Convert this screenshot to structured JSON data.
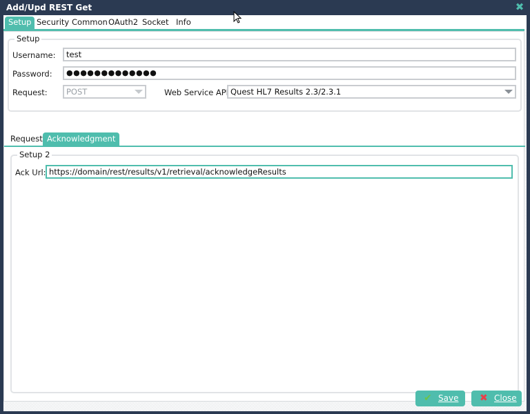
{
  "window": {
    "title": "Add/Upd REST Get",
    "close_icon": "close-x-icon"
  },
  "top_tabs": [
    {
      "label": "Setup",
      "active": true
    },
    {
      "label": "Security",
      "active": false
    },
    {
      "label": "Common",
      "active": false
    },
    {
      "label": "OAuth2",
      "active": false
    },
    {
      "label": "Socket",
      "active": false
    },
    {
      "label": "Info",
      "active": false
    }
  ],
  "setup": {
    "legend": "Setup",
    "username_label": "Username:",
    "username_value": "test",
    "password_label": "Password:",
    "password_value": "●●●●●●●●●●●●●",
    "request_label": "Request:",
    "request_value": "POST",
    "api_label": "Web Service API:",
    "api_value": "Quest HL7 Results 2.3/2.3.1"
  },
  "sub_tabs": [
    {
      "label": "Request",
      "active": false
    },
    {
      "label": "Acknowledgment",
      "active": true
    }
  ],
  "setup2": {
    "legend": "Setup 2",
    "ack_label": "Ack Url:",
    "ack_value": "https://domain/rest/results/v1/retrieval/acknowledgeResults"
  },
  "buttons": {
    "save_label": "Save",
    "save_icon": "check-icon",
    "close_label": "Close",
    "close_icon": "x-icon"
  },
  "colors": {
    "accent": "#4fbdad",
    "titlebar": "#2b3a52",
    "save_icon": "#6cc24a",
    "close_icon": "#e8404a"
  }
}
